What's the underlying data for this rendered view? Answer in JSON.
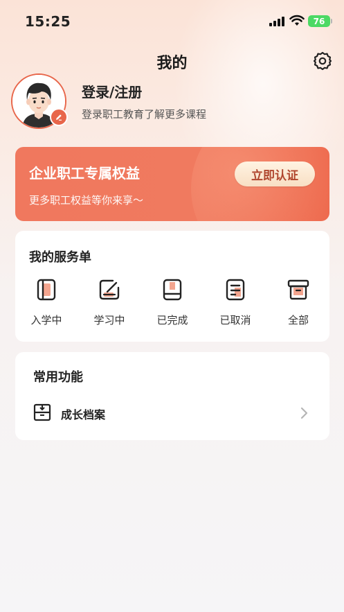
{
  "status_bar": {
    "time": "15:25",
    "battery": "76"
  },
  "header": {
    "title": "我的"
  },
  "profile": {
    "login_label": "登录/注册",
    "login_subtitle": "登录职工教育了解更多课程"
  },
  "benefit_banner": {
    "title": "企业职工专属权益",
    "subtitle": "更多职工权益等你来享～",
    "button_label": "立即认证"
  },
  "orders": {
    "title": "我的服务单",
    "items": [
      {
        "label": "入学中",
        "icon": "enrolling-icon"
      },
      {
        "label": "学习中",
        "icon": "studying-icon"
      },
      {
        "label": "已完成",
        "icon": "completed-icon"
      },
      {
        "label": "已取消",
        "icon": "cancelled-icon"
      },
      {
        "label": "全部",
        "icon": "all-orders-icon"
      }
    ]
  },
  "functions": {
    "title": "常用功能",
    "items": [
      {
        "label": "成长档案",
        "icon": "growth-archive-icon"
      }
    ]
  },
  "colors": {
    "accent": "#ee6e52",
    "verify_text": "#b0462e",
    "icon_accent": "#f3a58f"
  }
}
